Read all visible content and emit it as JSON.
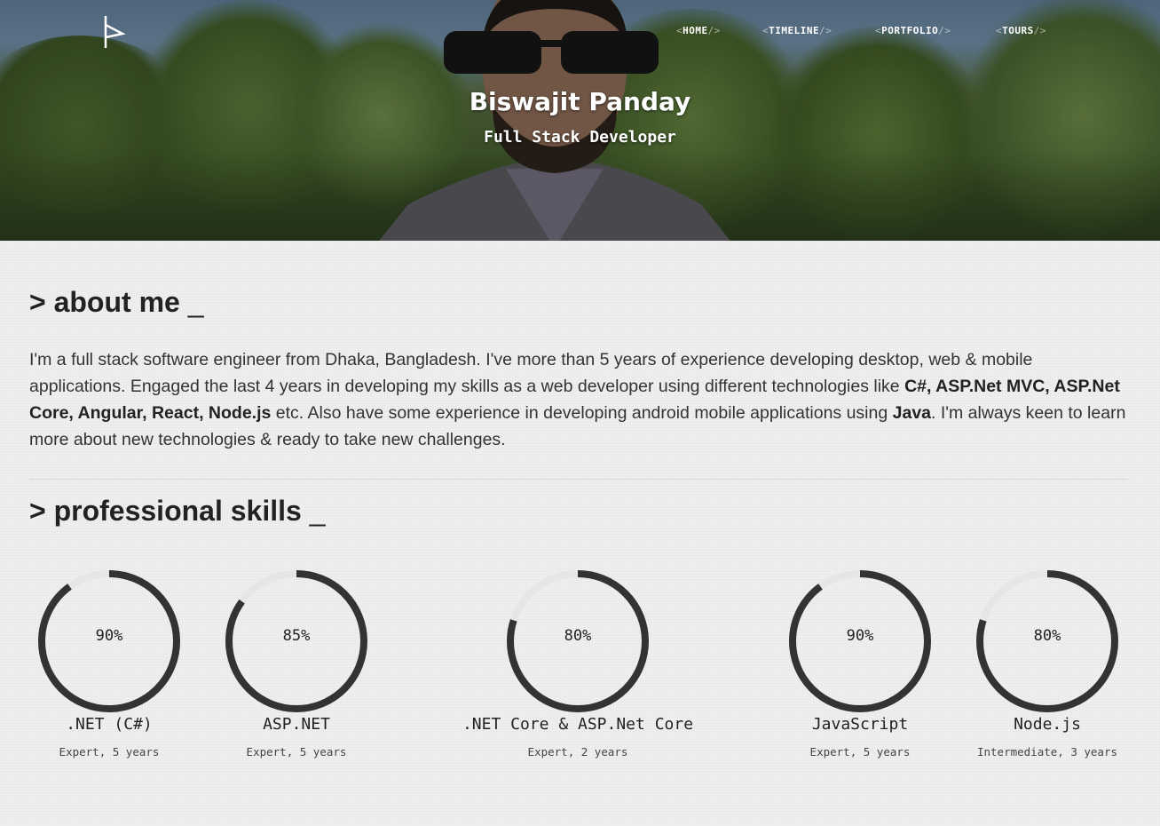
{
  "nav": {
    "items": [
      {
        "label": "HOME"
      },
      {
        "label": "TIMELINE"
      },
      {
        "label": "PORTFOLIO"
      },
      {
        "label": "TOURS"
      }
    ],
    "bracket_open": "<",
    "bracket_close": "/>"
  },
  "hero": {
    "name": "Biswajit Panday",
    "role": "Full Stack Developer"
  },
  "about": {
    "title": "> about me",
    "cursor": "_",
    "text_parts": [
      "I'm a full stack software engineer from Dhaka, Bangladesh. I've more than 5 years of experience developing desktop, web & mobile applications. Engaged the last 4 years in developing my skills as a web developer using different technologies like ",
      "C#, ASP.Net MVC, ASP.Net Core, Angular, React, Node.js",
      " etc. Also have some experience in developing android mobile applications using ",
      "Java",
      ". I'm always keen to learn more about new technologies & ready to take new challenges."
    ]
  },
  "skills": {
    "title": "> professional skills",
    "cursor": "_",
    "items": [
      {
        "percent": 90,
        "percent_label": "90%",
        "name": ".NET (C#)",
        "level": "Expert, 5 years"
      },
      {
        "percent": 85,
        "percent_label": "85%",
        "name": "ASP.NET",
        "level": "Expert, 5 years"
      },
      {
        "percent": 80,
        "percent_label": "80%",
        "name": ".NET Core & ASP.Net Core",
        "level": "Expert, 2 years"
      },
      {
        "percent": 90,
        "percent_label": "90%",
        "name": "JavaScript",
        "level": "Expert, 5 years"
      },
      {
        "percent": 80,
        "percent_label": "80%",
        "name": "Node.js",
        "level": "Intermediate, 3 years"
      }
    ]
  },
  "colors": {
    "ring_fill": "#333333",
    "ring_track": "#e6e6e6",
    "heading": "#222222",
    "background": "#efefef"
  }
}
